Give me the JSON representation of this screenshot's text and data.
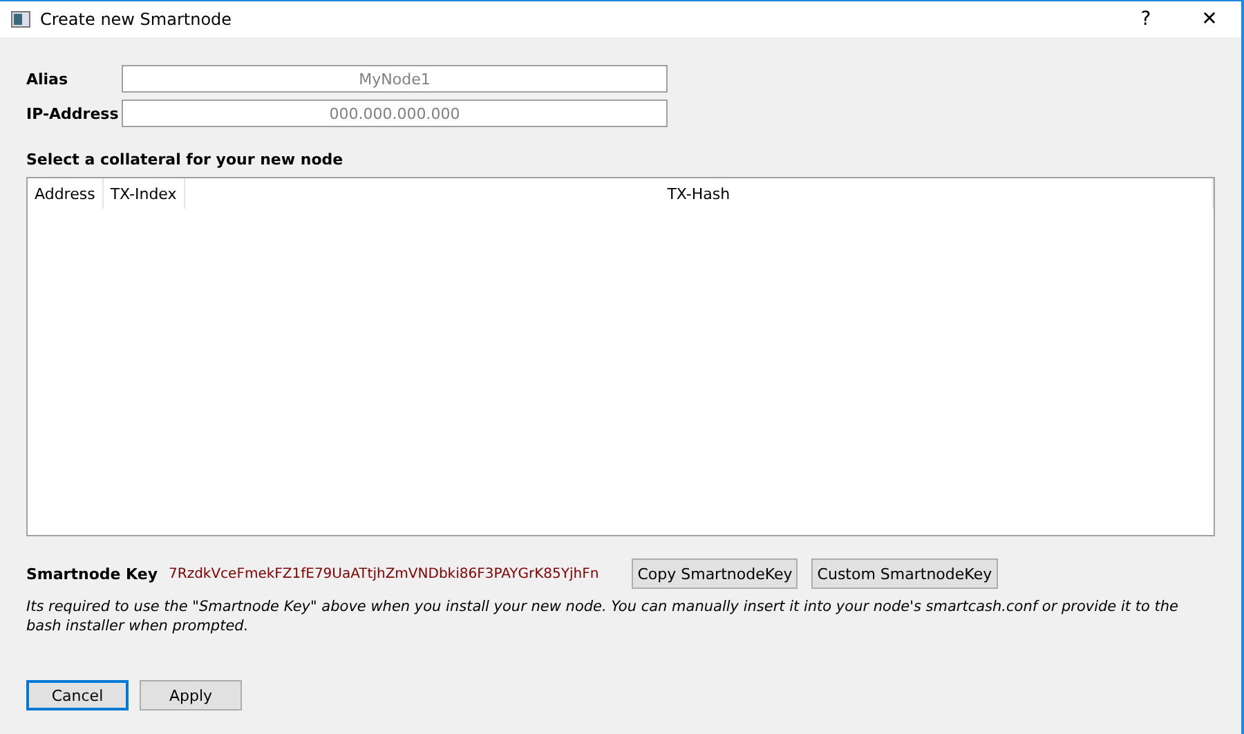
{
  "window": {
    "title": "Create new Smartnode",
    "help": "?",
    "close": "✕"
  },
  "fields": [
    {
      "label": "Alias",
      "placeholder": "MyNode1"
    },
    {
      "label": "IP-Address",
      "placeholder": "000.000.000.000"
    }
  ],
  "collateral": {
    "heading": "Select a collateral for your new node",
    "columns": [
      "Address",
      "TX-Index",
      "TX-Hash"
    ]
  },
  "smartnode_key": {
    "label": "Smartnode Key",
    "value": "7RzdkVceFmekFZ1fE79UaATtjhZmVNDbki86F3PAYGrK85YjhFn",
    "buttons": [
      "Copy SmartnodeKey",
      "Custom SmartnodeKey"
    ]
  },
  "note": "Its required to use the \"Smartnode Key\" above when you install your new node. You can manually insert it into your node's smartcash.conf or provide it to the bash installer when prompted.",
  "buttons": [
    {
      "label": "Cancel",
      "selected": true
    },
    {
      "label": "Apply",
      "selected": false
    }
  ]
}
